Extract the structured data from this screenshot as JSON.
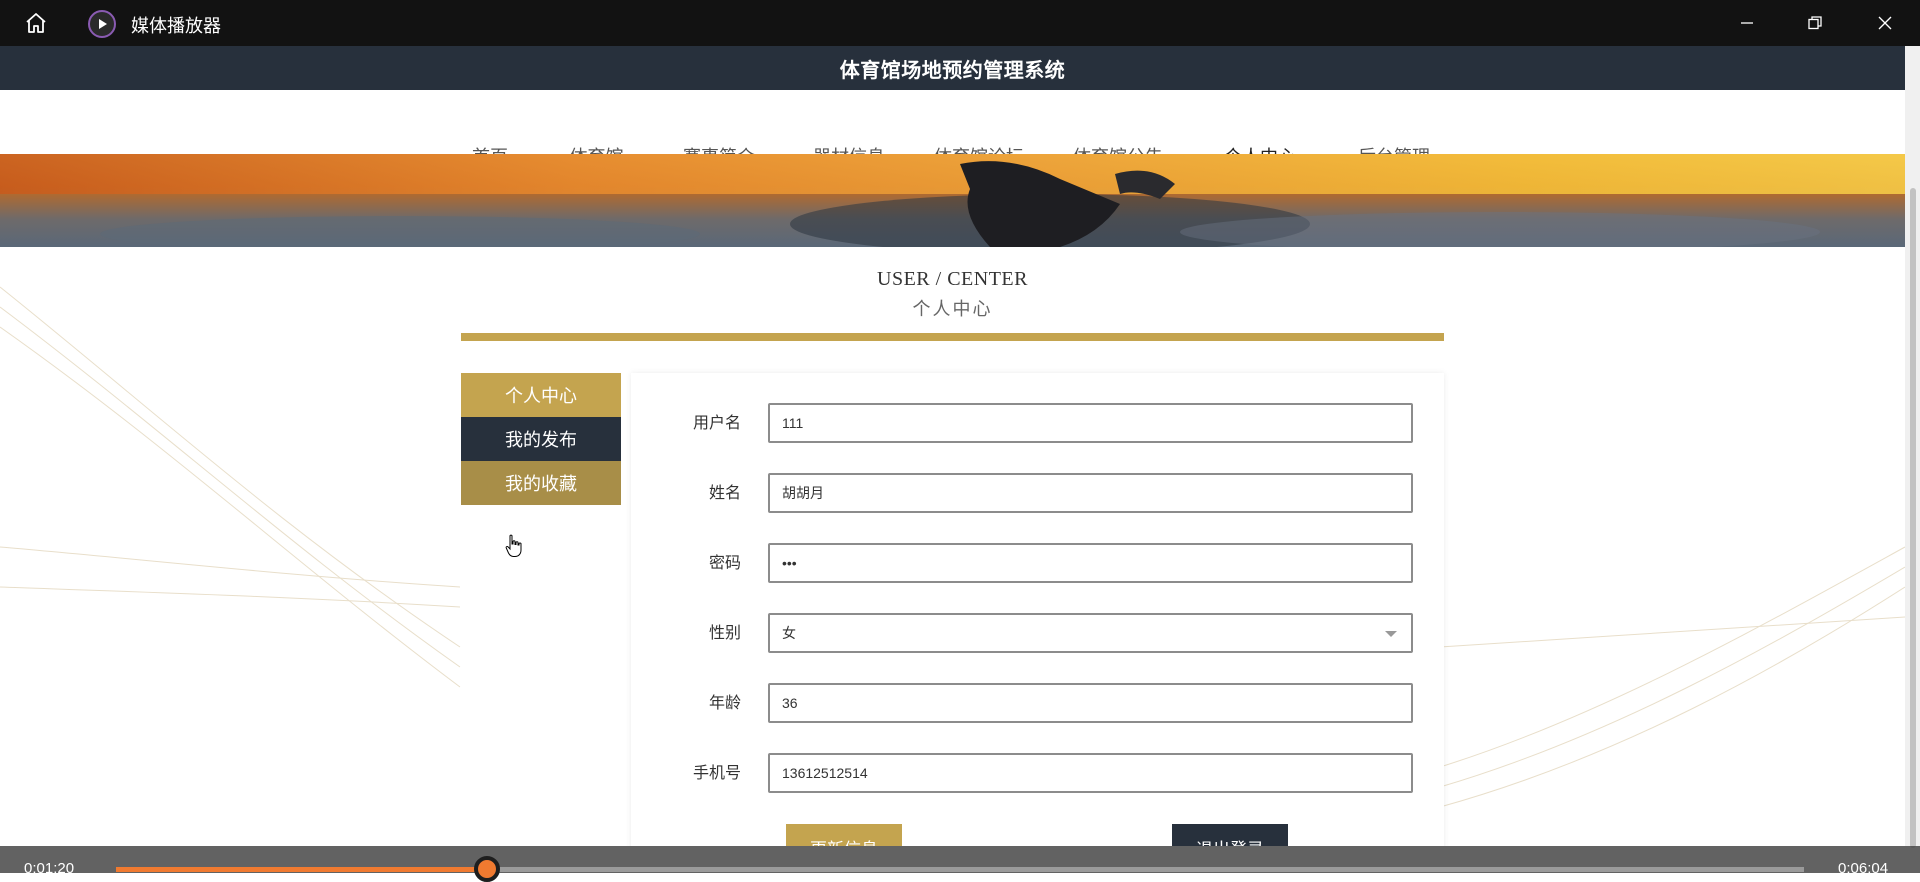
{
  "player": {
    "title": "媒体播放器",
    "current_time": "0:01:20",
    "total_time": "0:06:04",
    "progress_fraction": 0.22,
    "accent_color": "#f07a30"
  },
  "site": {
    "title": "体育馆场地预约管理系统",
    "nav": [
      {
        "label": "首页",
        "active": false
      },
      {
        "label": "体育馆",
        "active": false
      },
      {
        "label": "赛事简介",
        "active": false
      },
      {
        "label": "器材信息",
        "active": false
      },
      {
        "label": "体育馆论坛",
        "active": false
      },
      {
        "label": "体育馆公告",
        "active": false
      },
      {
        "label": "个人中心",
        "active": true
      },
      {
        "label": "后台管理",
        "active": false
      }
    ],
    "accent_color": "#c4a44f",
    "dark_color": "#27303c"
  },
  "section": {
    "title_en": "USER / CENTER",
    "title_cn": "个人中心"
  },
  "side_menu": [
    {
      "label": "个人中心"
    },
    {
      "label": "我的发布"
    },
    {
      "label": "我的收藏"
    }
  ],
  "form": {
    "fields": [
      {
        "label": "用户名",
        "value": "111"
      },
      {
        "label": "姓名",
        "value": "胡胡月"
      },
      {
        "label": "密码",
        "value": "•••"
      },
      {
        "label": "性别",
        "value": "女"
      },
      {
        "label": "年龄",
        "value": "36"
      },
      {
        "label": "手机号",
        "value": "13612512514"
      }
    ],
    "update_button": "更新信息",
    "logout_button": "退出登录"
  },
  "icons": {
    "home": "home-icon",
    "app": "play-icon",
    "minimize": "minimize-icon",
    "restore": "restore-icon",
    "close": "close-icon",
    "dropdown": "chevron-down-icon",
    "cursor": "hand-cursor-icon"
  }
}
